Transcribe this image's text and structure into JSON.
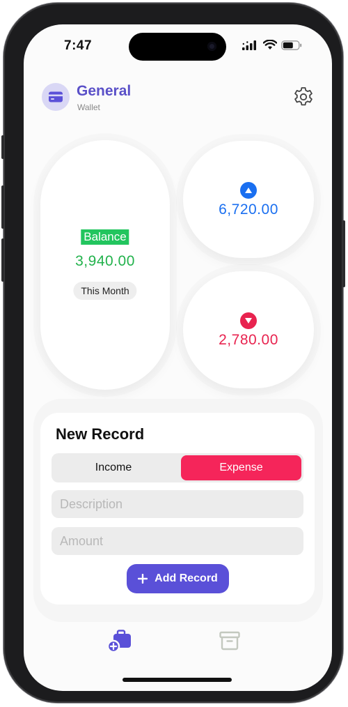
{
  "status_bar": {
    "time": "7:47"
  },
  "header": {
    "title": "General",
    "subtitle": "Wallet"
  },
  "summary": {
    "balance_label": "Balance",
    "balance_value": "3,940.00",
    "period": "This Month",
    "income_value": "6,720.00",
    "expense_value": "2,780.00"
  },
  "new_record": {
    "title": "New Record",
    "type_options": [
      "Income",
      "Expense"
    ],
    "selected_type": "Expense",
    "description_placeholder": "Description",
    "amount_placeholder": "Amount",
    "submit_label": "Add Record"
  },
  "tab_bar": {
    "items": [
      "add-record-tab",
      "archive-tab"
    ],
    "active": "add-record-tab"
  },
  "colors": {
    "accent": "#5a50d8",
    "income": "#1a6ff0",
    "expense": "#e8234f",
    "balance": "#22c55e"
  }
}
